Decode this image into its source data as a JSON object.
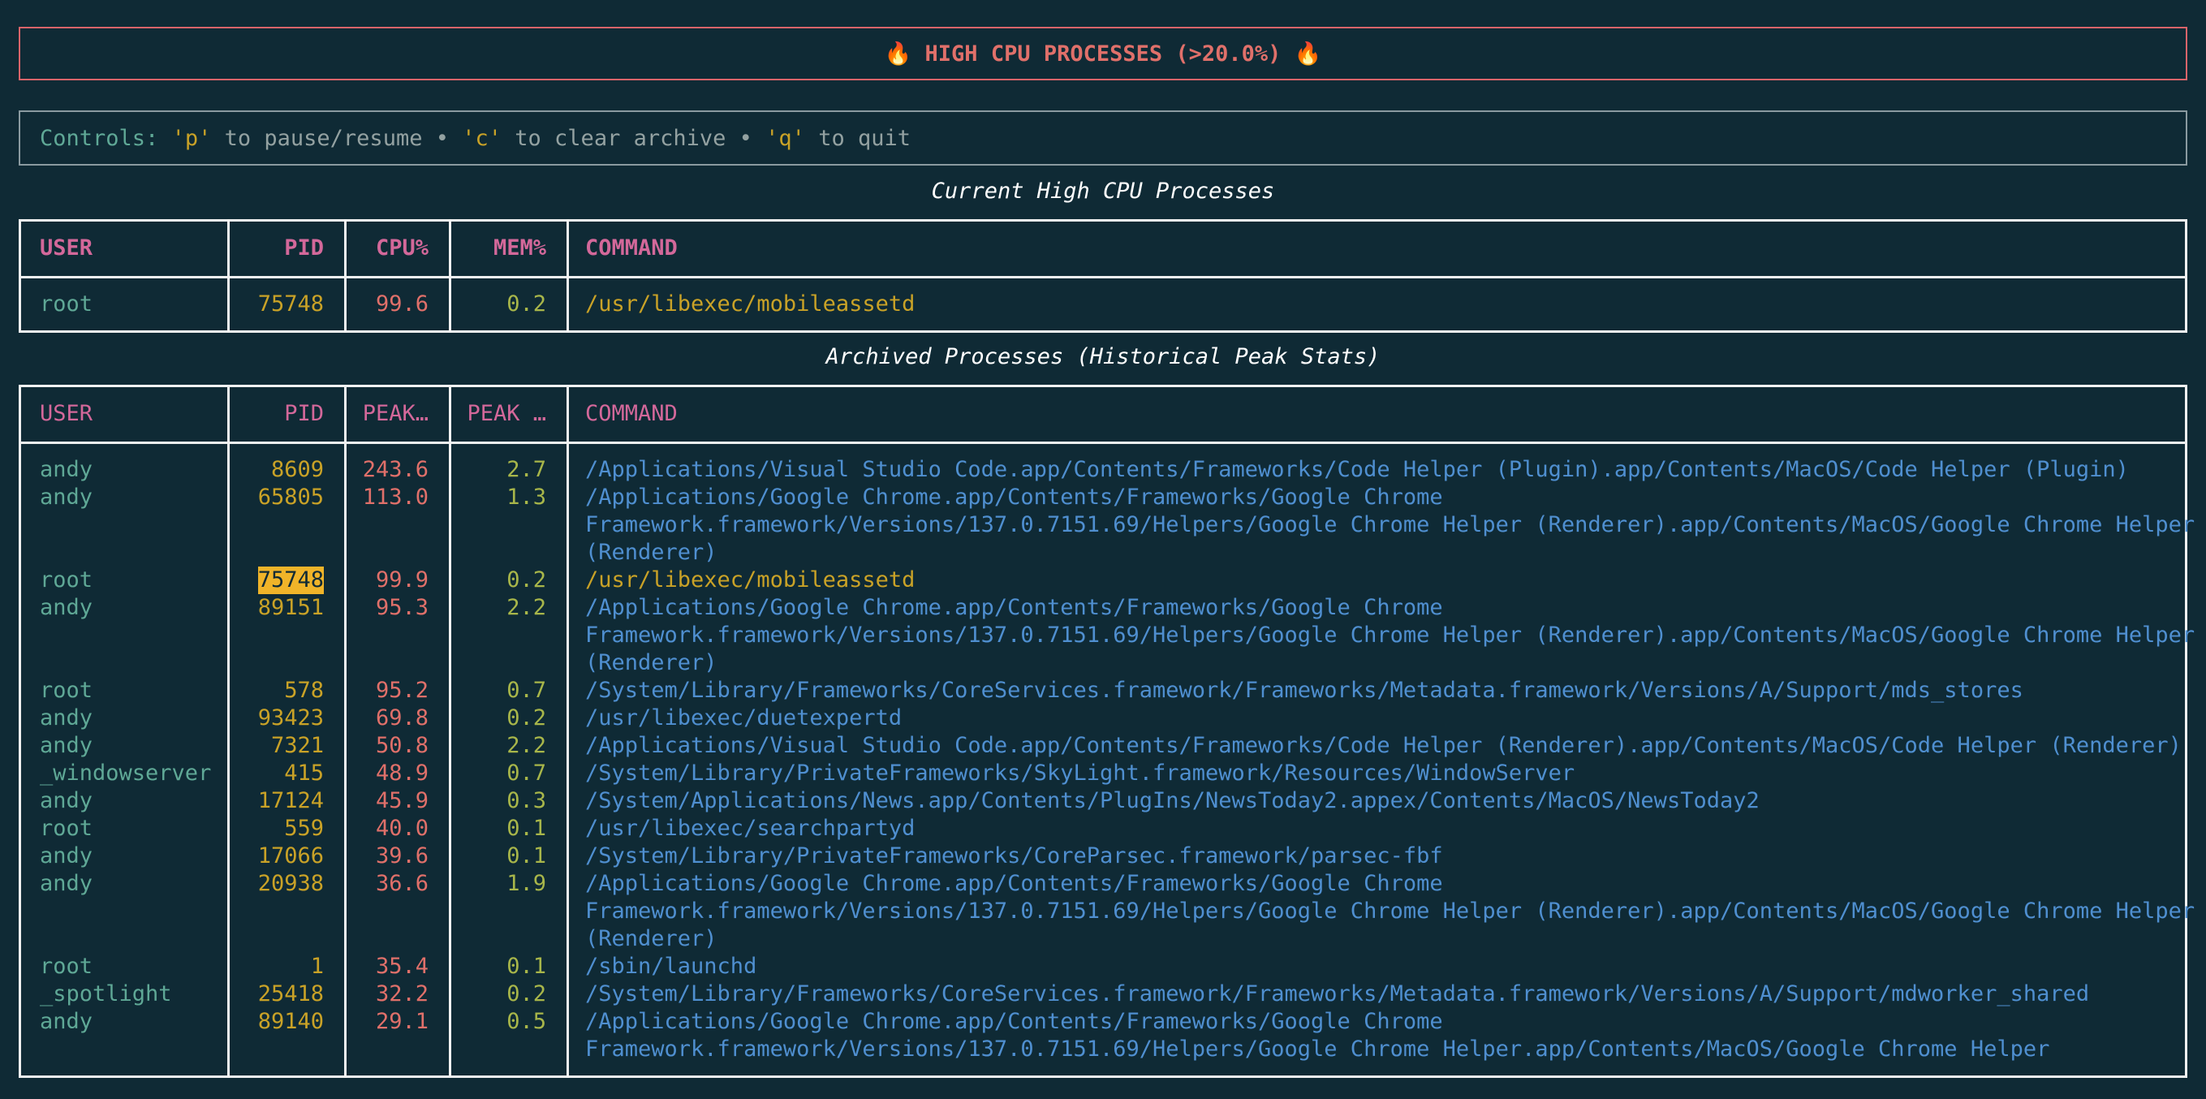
{
  "header": {
    "title": "🔥 HIGH CPU PROCESSES (>20.0%) 🔥"
  },
  "controls": {
    "label": "Controls:",
    "pause_key": "'p'",
    "pause_text": "to pause/resume •",
    "clear_key": "'c'",
    "clear_text": "to clear archive •",
    "quit_key": "'q'",
    "quit_text": "to quit"
  },
  "current": {
    "title": "Current High CPU Processes",
    "columns": [
      "USER",
      "PID",
      "CPU%",
      "MEM%",
      "COMMAND"
    ],
    "rows": [
      {
        "user": "root",
        "pid": "75748",
        "cpu": "99.6",
        "mem": "0.2",
        "cmd": "/usr/libexec/mobileassetd"
      }
    ]
  },
  "archive": {
    "title": "Archived Processes (Historical Peak Stats)",
    "columns": [
      "USER",
      "PID",
      "PEAK…",
      "PEAK …",
      "COMMAND"
    ],
    "rows": [
      {
        "user": "andy",
        "pid": "8609",
        "cpu": "243.6",
        "mem": "2.7",
        "cmd": [
          "/Applications/Visual Studio Code.app/Contents/Frameworks/Code Helper (Plugin).app/Contents/MacOS/Code Helper (Plugin)"
        ]
      },
      {
        "user": "andy",
        "pid": "65805",
        "cpu": "113.0",
        "mem": "1.3",
        "cmd": [
          "/Applications/Google Chrome.app/Contents/Frameworks/Google Chrome",
          "Framework.framework/Versions/137.0.7151.69/Helpers/Google Chrome Helper (Renderer).app/Contents/MacOS/Google Chrome Helper",
          "(Renderer)"
        ]
      },
      {
        "user": "root",
        "pid": "75748",
        "cpu": "99.9",
        "mem": "0.2",
        "cmd": [
          "/usr/libexec/mobileassetd"
        ],
        "current": true
      },
      {
        "user": "andy",
        "pid": "89151",
        "cpu": "95.3",
        "mem": "2.2",
        "cmd": [
          "/Applications/Google Chrome.app/Contents/Frameworks/Google Chrome",
          "Framework.framework/Versions/137.0.7151.69/Helpers/Google Chrome Helper (Renderer).app/Contents/MacOS/Google Chrome Helper",
          "(Renderer)"
        ]
      },
      {
        "user": "root",
        "pid": "578",
        "cpu": "95.2",
        "mem": "0.7",
        "cmd": [
          "/System/Library/Frameworks/CoreServices.framework/Frameworks/Metadata.framework/Versions/A/Support/mds_stores"
        ]
      },
      {
        "user": "andy",
        "pid": "93423",
        "cpu": "69.8",
        "mem": "0.2",
        "cmd": [
          "/usr/libexec/duetexpertd"
        ]
      },
      {
        "user": "andy",
        "pid": "7321",
        "cpu": "50.8",
        "mem": "2.2",
        "cmd": [
          "/Applications/Visual Studio Code.app/Contents/Frameworks/Code Helper (Renderer).app/Contents/MacOS/Code Helper (Renderer)"
        ]
      },
      {
        "user": "_windowserver",
        "pid": "415",
        "cpu": "48.9",
        "mem": "0.7",
        "cmd": [
          "/System/Library/PrivateFrameworks/SkyLight.framework/Resources/WindowServer"
        ]
      },
      {
        "user": "andy",
        "pid": "17124",
        "cpu": "45.9",
        "mem": "0.3",
        "cmd": [
          "/System/Applications/News.app/Contents/PlugIns/NewsToday2.appex/Contents/MacOS/NewsToday2"
        ]
      },
      {
        "user": "root",
        "pid": "559",
        "cpu": "40.0",
        "mem": "0.1",
        "cmd": [
          "/usr/libexec/searchpartyd"
        ]
      },
      {
        "user": "andy",
        "pid": "17066",
        "cpu": "39.6",
        "mem": "0.1",
        "cmd": [
          "/System/Library/PrivateFrameworks/CoreParsec.framework/parsec-fbf"
        ]
      },
      {
        "user": "andy",
        "pid": "20938",
        "cpu": "36.6",
        "mem": "1.9",
        "cmd": [
          "/Applications/Google Chrome.app/Contents/Frameworks/Google Chrome",
          "Framework.framework/Versions/137.0.7151.69/Helpers/Google Chrome Helper (Renderer).app/Contents/MacOS/Google Chrome Helper",
          "(Renderer)"
        ]
      },
      {
        "user": "root",
        "pid": "1",
        "cpu": "35.4",
        "mem": "0.1",
        "cmd": [
          "/sbin/launchd"
        ]
      },
      {
        "user": "_spotlight",
        "pid": "25418",
        "cpu": "32.2",
        "mem": "0.2",
        "cmd": [
          "/System/Library/Frameworks/CoreServices.framework/Frameworks/Metadata.framework/Versions/A/Support/mdworker_shared"
        ]
      },
      {
        "user": "andy",
        "pid": "89140",
        "cpu": "29.1",
        "mem": "0.5",
        "cmd": [
          "/Applications/Google Chrome.app/Contents/Frameworks/Google Chrome",
          "Framework.framework/Versions/137.0.7151.69/Helpers/Google Chrome Helper.app/Contents/MacOS/Google Chrome Helper"
        ]
      }
    ]
  }
}
